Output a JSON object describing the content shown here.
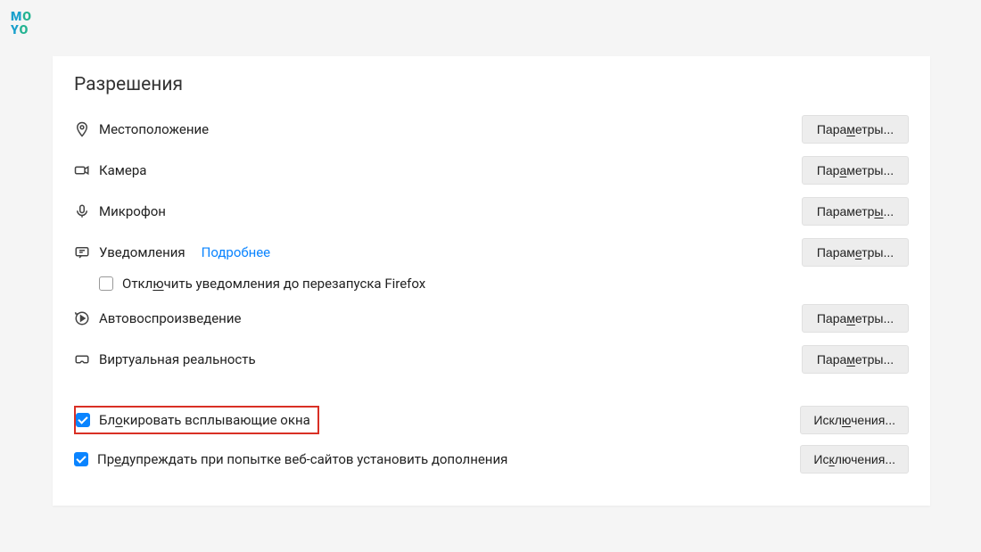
{
  "logo": {
    "m": "M",
    "o1": "O",
    "y": "Y",
    "o2": "O"
  },
  "section_title": "Разрешения",
  "rows": {
    "location": {
      "label": "Местоположение",
      "button_pre": "Пара",
      "button_u": "м",
      "button_post": "етры..."
    },
    "camera": {
      "label": "Камера",
      "button_pre": "Пар",
      "button_u": "а",
      "button_post": "метры..."
    },
    "microphone": {
      "label": "Микрофон",
      "button_pre": "Параметр",
      "button_u": "ы",
      "button_post": "..."
    },
    "notifications": {
      "label": "Уведомления",
      "link": "Подробнее",
      "button_pre": "Парам",
      "button_u": "е",
      "button_post": "тры..."
    },
    "notifications_disable": {
      "label_pre": "Откл",
      "label_u": "ю",
      "label_post": "чить уведомления до перезапуска Firefox"
    },
    "autoplay": {
      "label": "Автовоспроизведение",
      "button_pre": "Пара",
      "button_u": "м",
      "button_post": "етры..."
    },
    "vr": {
      "label": "Виртуальная реальность",
      "button_pre": "Пара",
      "button_u": "м",
      "button_post": "етры..."
    }
  },
  "block": {
    "popup": {
      "label_pre": "Бл",
      "label_u": "о",
      "label_post": "кировать всплывающие окна",
      "button_pre": "Искл",
      "button_u": "ю",
      "button_post": "чения..."
    },
    "addons": {
      "label_pre": "Пр",
      "label_u": "е",
      "label_post": "дупреждать при попытке веб-сайтов установить дополнения",
      "button_pre": "Ис",
      "button_u": "к",
      "button_post": "лючения..."
    }
  }
}
